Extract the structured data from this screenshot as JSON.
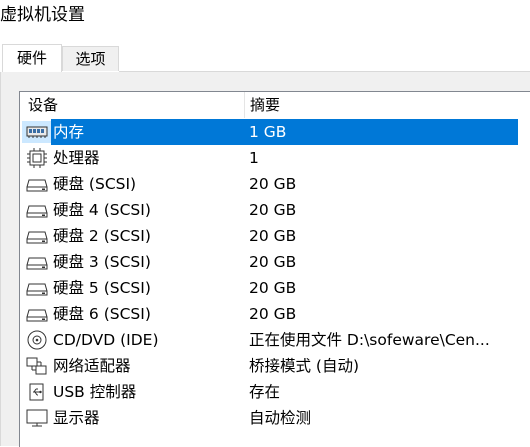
{
  "window": {
    "title": "虚拟机设置"
  },
  "tabs": [
    {
      "label": "硬件"
    },
    {
      "label": "选项"
    }
  ],
  "table": {
    "columns": [
      "设备",
      "摘要"
    ],
    "rows": [
      {
        "device": "内存",
        "summary": "1 GB",
        "icon": "memory-icon",
        "selected": true
      },
      {
        "device": "处理器",
        "summary": "1",
        "icon": "processor-icon"
      },
      {
        "device": "硬盘 (SCSI)",
        "summary": "20 GB",
        "icon": "hard-disk-icon"
      },
      {
        "device": "硬盘 4 (SCSI)",
        "summary": "20 GB",
        "icon": "hard-disk-icon"
      },
      {
        "device": "硬盘 2 (SCSI)",
        "summary": "20 GB",
        "icon": "hard-disk-icon"
      },
      {
        "device": "硬盘 3 (SCSI)",
        "summary": "20 GB",
        "icon": "hard-disk-icon"
      },
      {
        "device": "硬盘 5 (SCSI)",
        "summary": "20 GB",
        "icon": "hard-disk-icon"
      },
      {
        "device": "硬盘 6 (SCSI)",
        "summary": "20 GB",
        "icon": "hard-disk-icon"
      },
      {
        "device": "CD/DVD (IDE)",
        "summary": "正在使用文件 D:\\sofeware\\Cen...",
        "icon": "cd-dvd-icon"
      },
      {
        "device": "网络适配器",
        "summary": "桥接模式 (自动)",
        "icon": "network-adapter-icon"
      },
      {
        "device": "USB 控制器",
        "summary": "存在",
        "icon": "usb-controller-icon"
      },
      {
        "device": "显示器",
        "summary": "自动检测",
        "icon": "display-icon"
      }
    ]
  },
  "colors": {
    "selection": "#0078d7",
    "panel": "#f0f0f0"
  }
}
